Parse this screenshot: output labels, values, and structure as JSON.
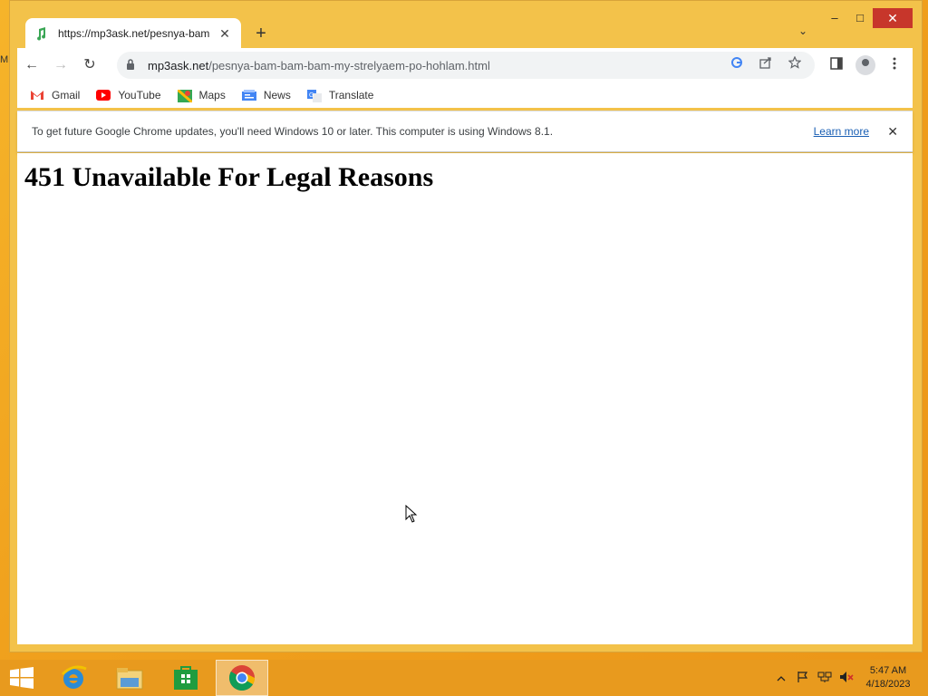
{
  "desktop": {
    "edge_label": "M"
  },
  "browser": {
    "tab": {
      "title": "https://mp3ask.net/pesnya-bam",
      "close": "✕"
    },
    "new_tab": "+",
    "tab_search": "⌄",
    "window_controls": {
      "minimize": "–",
      "maximize": "□",
      "close": "✕"
    },
    "nav": {
      "back": "←",
      "forward": "→",
      "reload": "↻"
    },
    "omnibox": {
      "host": "mp3ask.net",
      "path": "/pesnya-bam-bam-bam-my-strelyaem-po-hohlam.html",
      "lock": "🔒"
    },
    "bookmarks": [
      {
        "label": "Gmail",
        "icon": "gmail-icon",
        "color": "#ea4335"
      },
      {
        "label": "YouTube",
        "icon": "youtube-icon",
        "color": "#ff0000"
      },
      {
        "label": "Maps",
        "icon": "maps-icon",
        "color": "#34a853"
      },
      {
        "label": "News",
        "icon": "news-icon",
        "color": "#4285f4"
      },
      {
        "label": "Translate",
        "icon": "translate-icon",
        "color": "#4285f4"
      }
    ],
    "infobar": {
      "message": "To get future Google Chrome updates, you'll need Windows 10 or later. This computer is using Windows 8.1.",
      "learn_more": "Learn more",
      "close": "✕"
    }
  },
  "page": {
    "heading": "451 Unavailable For Legal Reasons"
  },
  "taskbar": {
    "apps": [
      "internet-explorer-icon",
      "file-explorer-icon",
      "store-icon",
      "chrome-icon"
    ],
    "active_app": "chrome-icon",
    "clock": {
      "time": "5:47 AM",
      "date": "4/18/2023"
    }
  },
  "colors": {
    "desktop": "#f0a11d",
    "window_frame": "#f3c24a",
    "close_button": "#c7362b",
    "link": "#1a5fb4"
  }
}
